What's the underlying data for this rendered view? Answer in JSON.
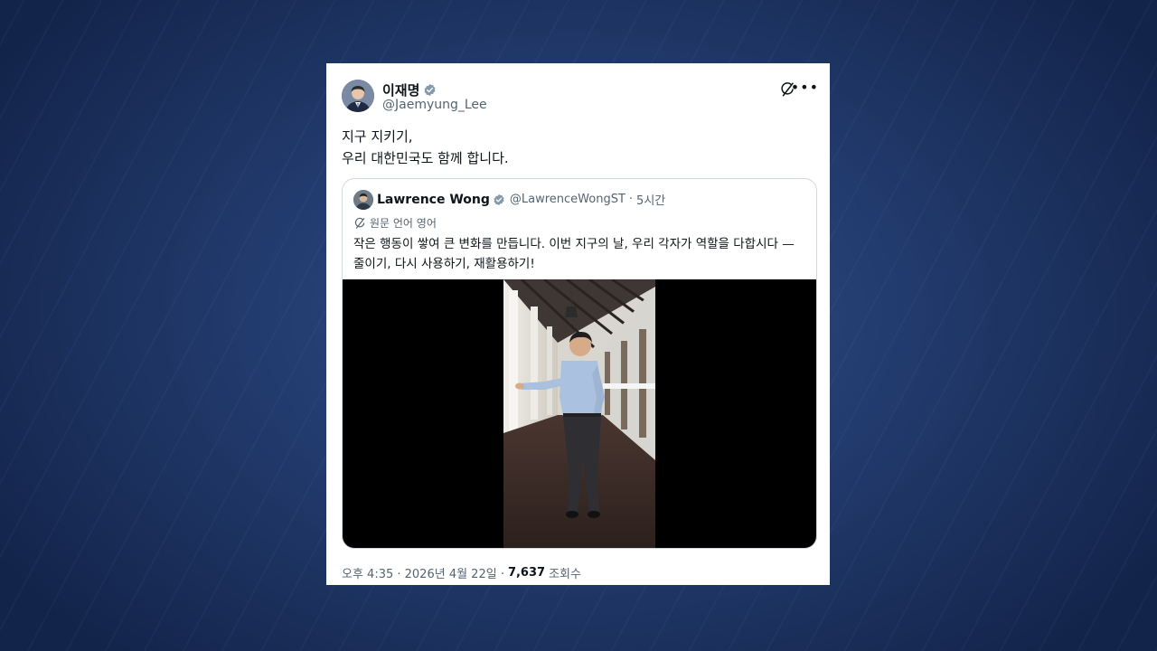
{
  "post": {
    "author_name": "이재명",
    "author_handle": "@Jaemyung_Lee",
    "text_lines": [
      "지구 지키기,",
      "우리 대한민국도 함께 합니다."
    ],
    "timestamp": "오후 4:35 · 2026년 4월 22일 ·",
    "views_count": "7,637",
    "views_label": "조회수"
  },
  "quote": {
    "author_name": "Lawrence Wong",
    "author_handle": "@LawrenceWongST",
    "separator": "·",
    "time": "5시간",
    "translation_note": "원문 언어 영어",
    "text_lines": [
      "작은 행동이 쌓여 큰 변화를 만듭니다. 이번 지구의 날, 우리 각자가 역할을 다합시다 —",
      "줄이기, 다시 사용하기, 재활용하기!"
    ]
  },
  "icons": {
    "verified": "verified-badge-icon",
    "grok": "grok-icon",
    "more": "more-options-icon",
    "translate": "translate-icon"
  },
  "colors": {
    "verified": "#829aab",
    "text_primary": "#0f1419",
    "text_secondary": "#536471",
    "border": "#cfd9de"
  }
}
